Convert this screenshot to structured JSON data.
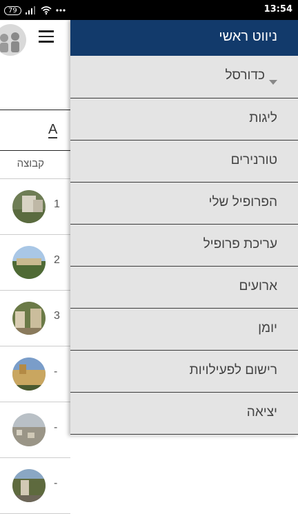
{
  "status_bar": {
    "battery": "79",
    "time": "13:54",
    "icons": [
      "battery-badge",
      "signal-icon",
      "wifi-icon",
      "more-dots-icon"
    ]
  },
  "background_screen": {
    "font_toggle": "A",
    "column_header": "קבוצה",
    "rows": [
      {
        "rank": "1",
        "thumb": "photo-1"
      },
      {
        "rank": "2",
        "thumb": "photo-2"
      },
      {
        "rank": "3",
        "thumb": "photo-3"
      },
      {
        "rank": "-",
        "thumb": "photo-4"
      },
      {
        "rank": "-",
        "thumb": "photo-5"
      },
      {
        "rank": "-",
        "thumb": "photo-6"
      }
    ]
  },
  "drawer": {
    "title": "ניווט ראשי",
    "header_color": "#123a6b",
    "items": [
      {
        "label": "כדורסל",
        "has_dropdown": true
      },
      {
        "label": "ליגות"
      },
      {
        "label": "טורנירים"
      },
      {
        "label": "הפרופיל שלי"
      },
      {
        "label": "עריכת פרופיל"
      },
      {
        "label": "ארועים"
      },
      {
        "label": "יומן"
      },
      {
        "label": "רישום לפעילויות"
      },
      {
        "label": "יציאה"
      }
    ]
  }
}
